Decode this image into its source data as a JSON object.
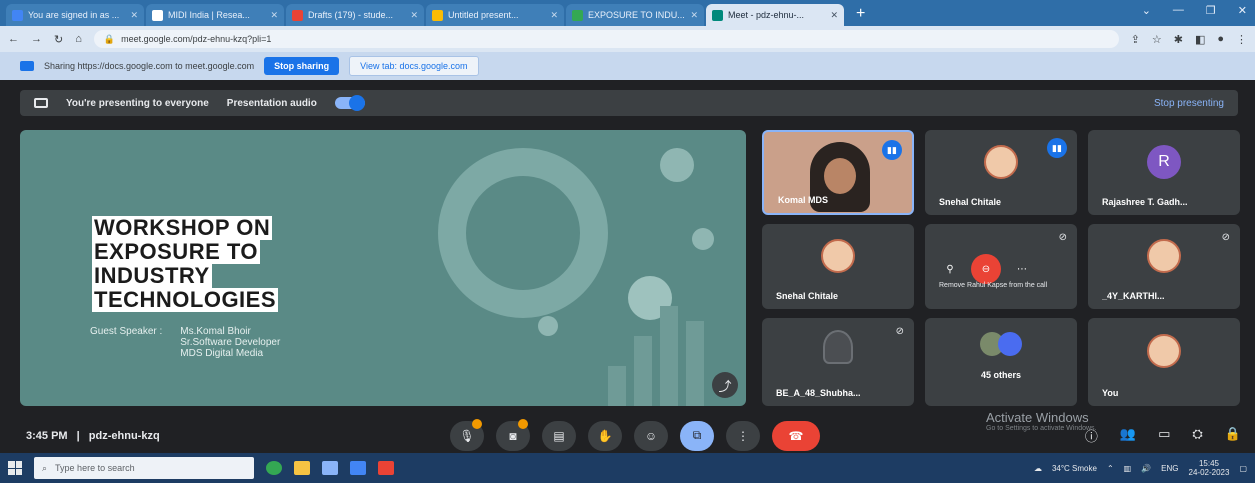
{
  "browser": {
    "tabs": [
      {
        "title": "You are signed in as ...",
        "color": "#4285f4"
      },
      {
        "title": "MIDI India | Resea...",
        "color": "#ffffff"
      },
      {
        "title": "Drafts (179) - stude...",
        "color": "#ea4335"
      },
      {
        "title": "Untitled present...",
        "color": "#fbbc04"
      },
      {
        "title": "EXPOSURE TO INDU...",
        "color": "#34a853"
      },
      {
        "title": "Meet - pdz-ehnu-...",
        "color": "#00897b"
      }
    ],
    "new_tab": "+",
    "url": "meet.google.com/pdz-ehnu-kzq?pli=1"
  },
  "share_bar": {
    "message": "Sharing https://docs.google.com to meet.google.com",
    "stop_label": "Stop sharing",
    "view_label": "View tab: docs.google.com"
  },
  "presenting_bar": {
    "message": "You're presenting to everyone",
    "audio_label": "Presentation audio",
    "stop_label": "Stop presenting"
  },
  "slide": {
    "title_lines": [
      "WORKSHOP ON",
      "EXPOSURE TO",
      "INDUSTRY",
      "TECHNOLOGIES"
    ],
    "speaker_label": "Guest Speaker :",
    "speaker_lines": [
      "Ms.Komal Bhoir",
      "Sr.Software Developer",
      "MDS Digital Media"
    ]
  },
  "participants": [
    {
      "name": "Komal MDS"
    },
    {
      "name": "Snehal Chitale"
    },
    {
      "name": "Rajashree T. Gadh...",
      "initial": "R"
    },
    {
      "name": "Snehal Chitale"
    },
    {
      "name": "",
      "tooltip": "Remove Rahul Kapse from the call"
    },
    {
      "name": "_4Y_KARTHI..."
    },
    {
      "name": "BE_A_48_Shubha..."
    },
    {
      "name": "45 others"
    },
    {
      "name": "You"
    }
  ],
  "meeting": {
    "time": "3:45 PM",
    "separator": "|",
    "code": "pdz-ehnu-kzq"
  },
  "watermark": {
    "title": "Activate Windows",
    "subtitle": "Go to Settings to activate Windows."
  },
  "taskbar": {
    "search_placeholder": "Type here to search",
    "weather": "34°C Smoke",
    "lang": "ENG",
    "time": "15:45",
    "date": "24-02-2023"
  }
}
